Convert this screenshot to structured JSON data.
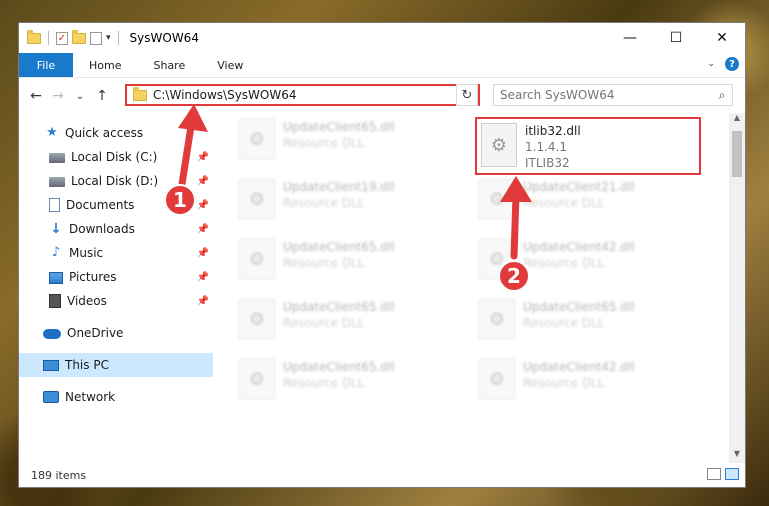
{
  "window": {
    "title": "SysWOW64",
    "controls": {
      "minimize": "—",
      "maximize": "☐",
      "close": "✕"
    }
  },
  "ribbon": {
    "tabs": [
      {
        "label": "File",
        "active": true
      },
      {
        "label": "Home"
      },
      {
        "label": "Share"
      },
      {
        "label": "View"
      }
    ],
    "help": "?"
  },
  "nav": {
    "back": "←",
    "forward": "→",
    "recent": "⌄",
    "up": "↑",
    "address": "C:\\Windows\\SysWOW64",
    "refresh": "↻",
    "search_placeholder": "Search SysWOW64"
  },
  "sidebar": {
    "items": [
      {
        "label": "Quick access",
        "icon": "star-icon"
      },
      {
        "label": "Local Disk (C:)",
        "icon": "disk-icon",
        "pinned": true
      },
      {
        "label": "Local Disk (D:)",
        "icon": "disk-icon",
        "pinned": true
      },
      {
        "label": "Documents",
        "icon": "document-icon",
        "pinned": true
      },
      {
        "label": "Downloads",
        "icon": "download-icon",
        "pinned": true
      },
      {
        "label": "Music",
        "icon": "music-icon",
        "pinned": true
      },
      {
        "label": "Pictures",
        "icon": "pictures-icon",
        "pinned": true
      },
      {
        "label": "Videos",
        "icon": "videos-icon",
        "pinned": true
      },
      {
        "label": "OneDrive",
        "icon": "onedrive-icon"
      },
      {
        "label": "This PC",
        "icon": "this-pc-icon",
        "selected": true
      },
      {
        "label": "Network",
        "icon": "network-icon"
      }
    ]
  },
  "files": [
    {
      "name": "UpdateClient65.dll",
      "type": "Resource DLL"
    },
    {
      "name": "itlib32.dll",
      "version": "1.1.4.1",
      "description": "ITLIB32",
      "highlighted": true
    },
    {
      "name": "UpdateClient19.dll",
      "type": "Resource DLL"
    },
    {
      "name": "UpdateClient21.dll",
      "type": "Resource DLL"
    },
    {
      "name": "UpdateClient65.dll",
      "type": "Resource DLL"
    },
    {
      "name": "UpdateClient42.dll",
      "type": "Resource DLL"
    },
    {
      "name": "UpdateClient65.dll",
      "type": "Resource DLL"
    },
    {
      "name": "UpdateClient65.dll",
      "type": "Resource DLL"
    },
    {
      "name": "UpdateClient65.dll",
      "type": "Resource DLL"
    },
    {
      "name": "UpdateClient42.dll",
      "type": "Resource DLL"
    }
  ],
  "status": {
    "item_count": "189 items"
  },
  "annotations": {
    "badge1": "1",
    "badge2": "2",
    "color": "#e03a3a"
  }
}
